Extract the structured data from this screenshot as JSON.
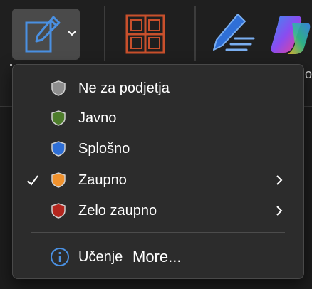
{
  "ribbon": {
    "sensitivity_button_icon": "document-pencil-icon",
    "grid_icon": "grid-icon",
    "pen_icon": "pen-icon",
    "copilot_icon": "copilot-icon",
    "tail_text": "o"
  },
  "menu": {
    "items": [
      {
        "label": "Ne za podjetja",
        "shield_color": "#8e8e8e",
        "checked": false,
        "has_submenu": false
      },
      {
        "label": "Javno",
        "shield_color": "#4e7d2c",
        "checked": false,
        "has_submenu": false
      },
      {
        "label": "Splošno",
        "shield_color": "#2f6fd6",
        "checked": false,
        "has_submenu": false
      },
      {
        "label": "Zaupno",
        "shield_color": "#f0922e",
        "checked": true,
        "has_submenu": true
      },
      {
        "label": "Zelo zaupno",
        "shield_color": "#b3261e",
        "checked": false,
        "has_submenu": true
      }
    ],
    "learn": {
      "label1": "Učenje",
      "label2": "More..."
    }
  },
  "colors": {
    "menu_bg": "#2c2c2c",
    "accent_blue": "#4a90e2",
    "grid_orange": "#c8502c"
  }
}
